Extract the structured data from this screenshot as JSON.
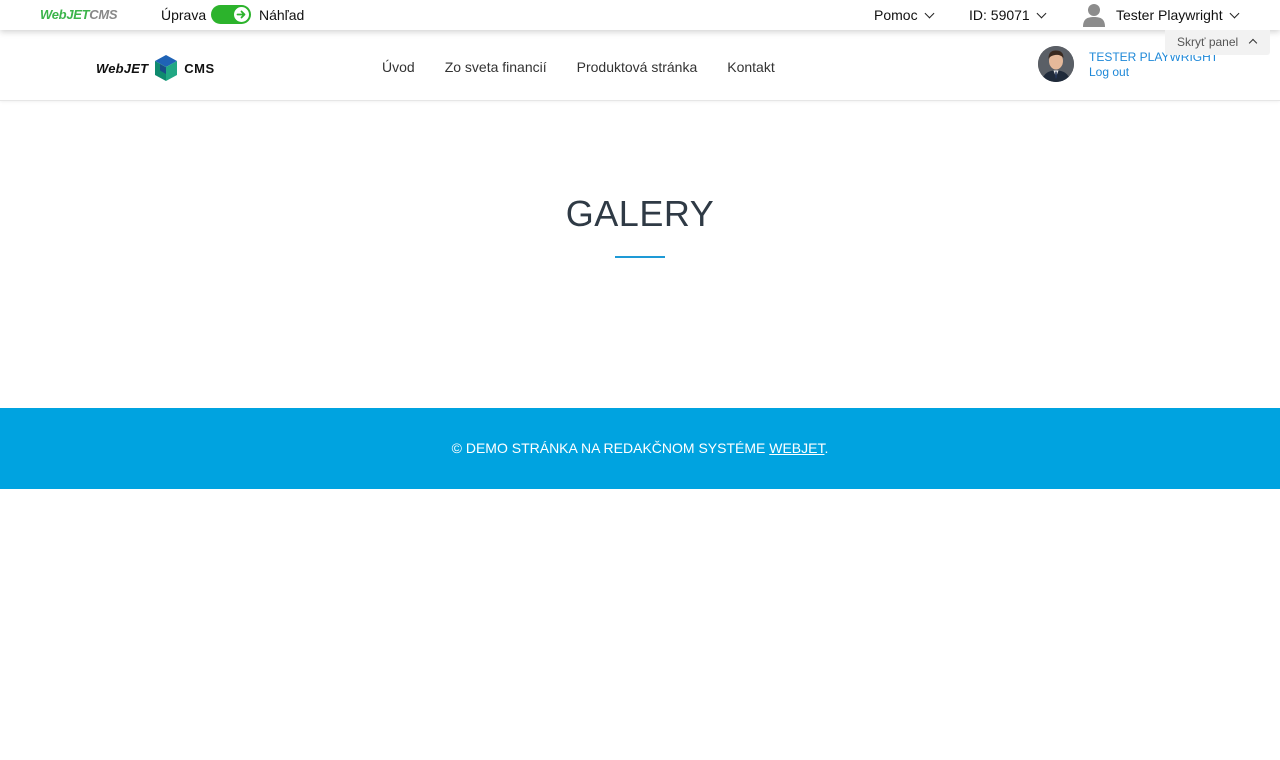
{
  "admin_bar": {
    "logo": {
      "web": "Web",
      "jet": "JET",
      "cms": "CMS"
    },
    "mode_edit_label": "Úprava",
    "mode_preview_label": "Náhľad",
    "help_label": "Pomoc",
    "doc_id_label": "ID: 59071",
    "user_label": "Tester Playwright",
    "hide_panel_label": "Skryť panel",
    "toggle_color": "#2cb32c"
  },
  "site_header": {
    "logo": {
      "word": "WebJET",
      "cms": "CMS"
    },
    "nav": [
      "Úvod",
      "Zo sveta financií",
      "Produktová stránka",
      "Kontakt"
    ],
    "user_name": "TESTER PLAYWRIGHT",
    "logout_label": "Log out"
  },
  "main": {
    "title": "GALERY"
  },
  "footer": {
    "text_prefix": "© DEMO STRÁNKA NA REDAKČNOM SYSTÉME ",
    "link_label": "WEBJET",
    "text_suffix": ".",
    "background_color": "#00a3e0"
  }
}
